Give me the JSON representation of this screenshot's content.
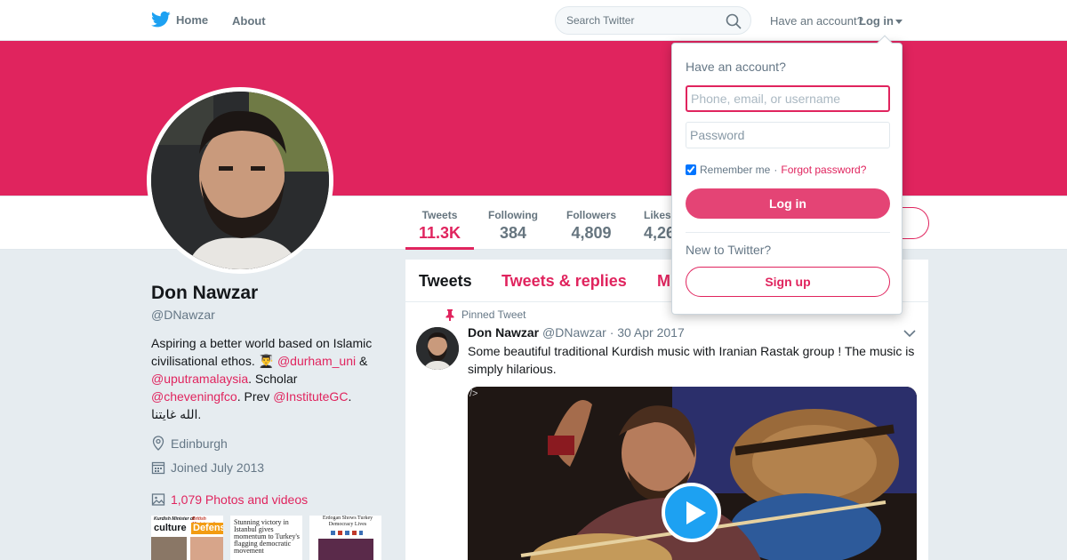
{
  "colors": {
    "accent": "#e0245e",
    "twitter_blue": "#1da1f2",
    "muted": "#657786"
  },
  "nav": {
    "home_label": "Home",
    "about_label": "About",
    "search_placeholder": "Search Twitter",
    "have_account": "Have an account?",
    "login_label": "Log in"
  },
  "stats": [
    {
      "label": "Tweets",
      "value": "11.3K"
    },
    {
      "label": "Following",
      "value": "384"
    },
    {
      "label": "Followers",
      "value": "4,809"
    },
    {
      "label": "Likes",
      "value": "4,26"
    }
  ],
  "profile": {
    "name": "Don Nawzar",
    "handle": "@DNawzar",
    "bio_line1": "Aspiring a better world based on Islamic",
    "bio_line2a": "civilisational ethos. ",
    "bio_emoji": "👨‍🎓",
    "bio_link1": "@durham_uni",
    "bio_amp": " &",
    "bio_link2": "@uputramalaysia",
    "bio_scholar": ". Scholar",
    "bio_link3": "@cheveningfco",
    "bio_prev": ". Prev ",
    "bio_link4": "@InstituteGC",
    "bio_dot": ".",
    "bio_arabic": "الله غايتنا.",
    "location": "Edinburgh",
    "joined": "Joined July 2013",
    "photos_videos": "1,079 Photos and videos",
    "thumbs": [
      {
        "line1": "Kurdish Minister of",
        "line2": "culture",
        "line3": "British Minister of",
        "line4": "Defense"
      },
      {
        "text": "Stunning victory in Istanbul gives momentum to Turkey's flagging democratic movement"
      },
      {
        "text": "Erdogan Shows Turkey Democracy Lives"
      }
    ]
  },
  "timeline": {
    "tabs": [
      "Tweets",
      "Tweets & replies",
      "M"
    ],
    "pinned_label": "Pinned Tweet",
    "tweet": {
      "author": "Don Nawzar",
      "handle": "@DNawzar",
      "date": "· 30 Apr 2017",
      "text": "Some beautiful traditional Kurdish music with Iranian Rastak group ! The music is simply hilarious.",
      "media_label": "/>"
    }
  },
  "login_dropdown": {
    "title": "Have an account?",
    "username_placeholder": "Phone, email, or username",
    "password_placeholder": "Password",
    "remember_me": "Remember me",
    "separator": " · ",
    "forgot_password": "Forgot password?",
    "login_button": "Log in",
    "new_to_twitter": "New to Twitter?",
    "signup_button": "Sign up"
  }
}
